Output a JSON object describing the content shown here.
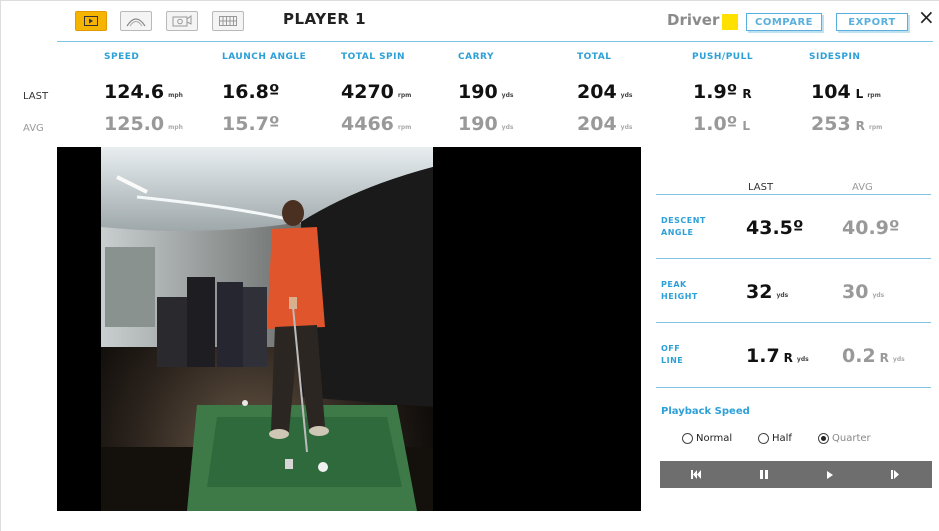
{
  "header": {
    "mode_buttons": [
      {
        "icon": "video-icon",
        "active": true
      },
      {
        "icon": "trajectory-icon",
        "active": false
      },
      {
        "icon": "camera-icon",
        "active": false
      },
      {
        "icon": "table-icon",
        "active": false
      }
    ],
    "player_title": "PLAYER 1",
    "club_name": "Driver",
    "club_color": "#ffe100",
    "compare_label": "COMPARE",
    "export_label": "EXPORT",
    "close_symbol": "×"
  },
  "stats": {
    "row_labels": {
      "last": "LAST",
      "avg": "AVG"
    },
    "columns": [
      {
        "header": "SPEED",
        "last": "124.6",
        "last_unit": "mph",
        "last_dir": "",
        "avg": "125.0",
        "avg_unit": "mph",
        "avg_dir": ""
      },
      {
        "header": "LAUNCH ANGLE",
        "last": "16.8º",
        "last_unit": "",
        "last_dir": "",
        "avg": "15.7º",
        "avg_unit": "",
        "avg_dir": ""
      },
      {
        "header": "TOTAL SPIN",
        "last": "4270",
        "last_unit": "rpm",
        "last_dir": "",
        "avg": "4466",
        "avg_unit": "rpm",
        "avg_dir": ""
      },
      {
        "header": "CARRY",
        "last": "190",
        "last_unit": "yds",
        "last_dir": "",
        "avg": "190",
        "avg_unit": "yds",
        "avg_dir": ""
      },
      {
        "header": "TOTAL",
        "last": "204",
        "last_unit": "yds",
        "last_dir": "",
        "avg": "204",
        "avg_unit": "yds",
        "avg_dir": ""
      },
      {
        "header": "PUSH/PULL",
        "last": "1.9º",
        "last_unit": "",
        "last_dir": "R",
        "avg": "1.0º",
        "avg_unit": "",
        "avg_dir": "L"
      },
      {
        "header": "SIDESPIN",
        "last": "104",
        "last_unit": "rpm",
        "last_dir": "L",
        "avg": "253",
        "avg_unit": "rpm",
        "avg_dir": "R"
      }
    ]
  },
  "panel": {
    "last_header": "LAST",
    "avg_header": "AVG",
    "rows": [
      {
        "label_line1": "DESCENT",
        "label_line2": "ANGLE",
        "last": "43.5º",
        "last_dir": "",
        "last_unit": "",
        "avg": "40.9º",
        "avg_dir": "",
        "avg_unit": ""
      },
      {
        "label_line1": "PEAK",
        "label_line2": "HEIGHT",
        "last": "32",
        "last_dir": "",
        "last_unit": "yds",
        "avg": "30",
        "avg_dir": "",
        "avg_unit": "yds"
      },
      {
        "label_line1": "OFF",
        "label_line2": "LINE",
        "last": "1.7",
        "last_dir": "R",
        "last_unit": "yds",
        "avg": "0.2",
        "avg_dir": "R",
        "avg_unit": "yds"
      }
    ]
  },
  "playback": {
    "title": "Playback Speed",
    "options": [
      {
        "label": "Normal",
        "selected": false
      },
      {
        "label": "Half",
        "selected": false
      },
      {
        "label": "Quarter",
        "selected": true
      }
    ],
    "controls": [
      {
        "icon": "skip-back-icon"
      },
      {
        "icon": "pause-icon"
      },
      {
        "icon": "play-icon"
      },
      {
        "icon": "step-forward-icon"
      }
    ]
  }
}
